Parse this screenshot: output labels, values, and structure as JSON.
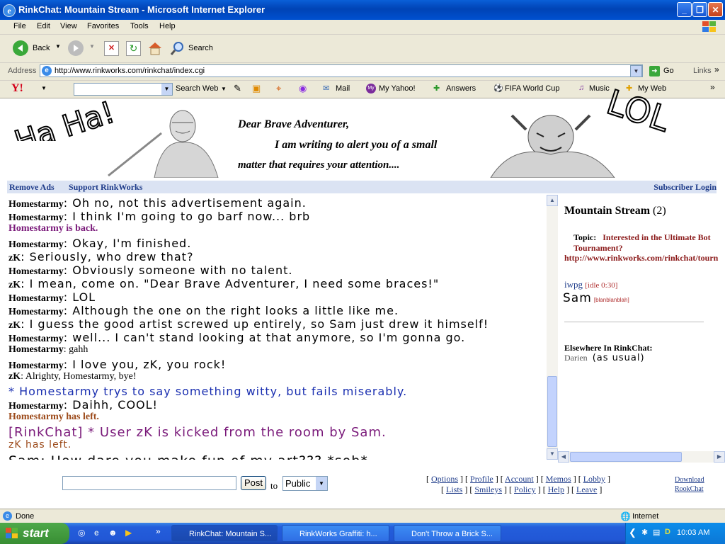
{
  "window": {
    "title": "RinkChat: Mountain Stream - Microsoft Internet Explorer"
  },
  "menu": [
    "File",
    "Edit",
    "View",
    "Favorites",
    "Tools",
    "Help"
  ],
  "toolbar": {
    "back": "Back",
    "search": "Search"
  },
  "address": {
    "label": "Address",
    "url": "http://www.rinkworks.com/rinkchat/index.cgi",
    "go": "Go",
    "links": "Links"
  },
  "yahoo": {
    "search_web": "Search Web",
    "mail": "Mail",
    "my_yahoo": "My Yahoo!",
    "answers": "Answers",
    "fifa": "FIFA World Cup",
    "music": "Music",
    "my_web": "My Web"
  },
  "graffiti": {
    "left": "Ha Ha!",
    "right": "LOL"
  },
  "banner": {
    "line1": "Dear Brave Adventurer,",
    "line2": "I am writing to alert you of a small",
    "line3": "matter that requires your attention...."
  },
  "nav": {
    "remove_ads": "Remove Ads",
    "support": "Support RinkWorks",
    "login": "Subscriber Login"
  },
  "chat": [
    {
      "who": "Homestarmy",
      "text": ": Oh no, not this advertisement again.",
      "type": "msg"
    },
    {
      "who": "Homestarmy",
      "text": ": I think I'm going to go barf now... brb",
      "type": "msg"
    },
    {
      "who": "",
      "text": "Homestarmy is back.",
      "type": "back"
    },
    {
      "who": "Homestarmy",
      "text": ": Okay, I'm finished.",
      "type": "msg"
    },
    {
      "who": "zK",
      "text": ": Seriously, who drew that?",
      "type": "msg"
    },
    {
      "who": "Homestarmy",
      "text": ": Obviously someone with no talent.",
      "type": "msg"
    },
    {
      "who": "zK",
      "text": ": I mean, come on. \"Dear Brave Adventurer, I need some braces!\"",
      "type": "msg"
    },
    {
      "who": "Homestarmy",
      "text": ": LOL",
      "type": "msg"
    },
    {
      "who": "Homestarmy",
      "text": ": Although the one on the right looks a little like me.",
      "type": "msg"
    },
    {
      "who": "zK",
      "text": ": I guess the good artist  screwed up entirely, so Sam just drew it himself!",
      "type": "msg"
    },
    {
      "who": "Homestarmy",
      "text": ": well... I can't stand looking at that anymore, so I'm gonna go.",
      "type": "msg"
    },
    {
      "who": "Homestarmy",
      "text": ": gahh",
      "type": "msg"
    },
    {
      "who": "Homestarmy",
      "text": ": I love you, zK, you rock!",
      "type": "msg"
    },
    {
      "who": "zK",
      "text": ": Alrighty, Homestarmy, bye!",
      "type": "msg"
    },
    {
      "who": "",
      "text": "* Homestarmy trys to say something witty, but fails miserably.",
      "type": "action"
    },
    {
      "who": "Homestarmy",
      "text": ":  Daihh, COOL!",
      "type": "msg"
    },
    {
      "who": "",
      "text": "Homestarmy has left.",
      "type": "left"
    },
    {
      "who": "",
      "text": "[RinkChat] * User zK is kicked from the room by Sam.",
      "type": "kick"
    },
    {
      "who": "",
      "text": "zK has left.",
      "type": "left2"
    },
    {
      "who": "",
      "text": "Sam: How dare you make fun of my art??? *sob*",
      "type": "sam"
    }
  ],
  "room": {
    "name": "Mountain Stream",
    "count": "(2)",
    "topic_label": "Topic:",
    "topic": "Interested in the Ultimate Bot Tournament?",
    "topic_url": "http://www.rinkworks.com/rinkchat/tourn",
    "users": [
      {
        "name": "iwpg",
        "status": "[idle 0:30]"
      },
      {
        "name": "Sam",
        "status": "[blanblanblah]"
      }
    ],
    "elsewhere_label": "Elsewhere In RinkChat:",
    "elsewhere_user": "Darien",
    "elsewhere_note": "(as usual)"
  },
  "post": {
    "button": "Post",
    "to": "to",
    "target": "Public"
  },
  "footer": {
    "links1": [
      "Options",
      "Profile",
      "Account",
      "Memos",
      "Lobby"
    ],
    "links2": [
      "Lists",
      "Smileys",
      "Policy",
      "Help",
      "Leave"
    ],
    "download": "Download",
    "rookchat": "RookChat"
  },
  "status": {
    "text": "Done",
    "zone": "Internet"
  },
  "taskbar": {
    "start": "start",
    "tasks": [
      "RinkChat: Mountain S...",
      "RinkWorks Graffiti: h...",
      "Don't Throw a Brick S..."
    ],
    "clock": "10:03 AM"
  }
}
